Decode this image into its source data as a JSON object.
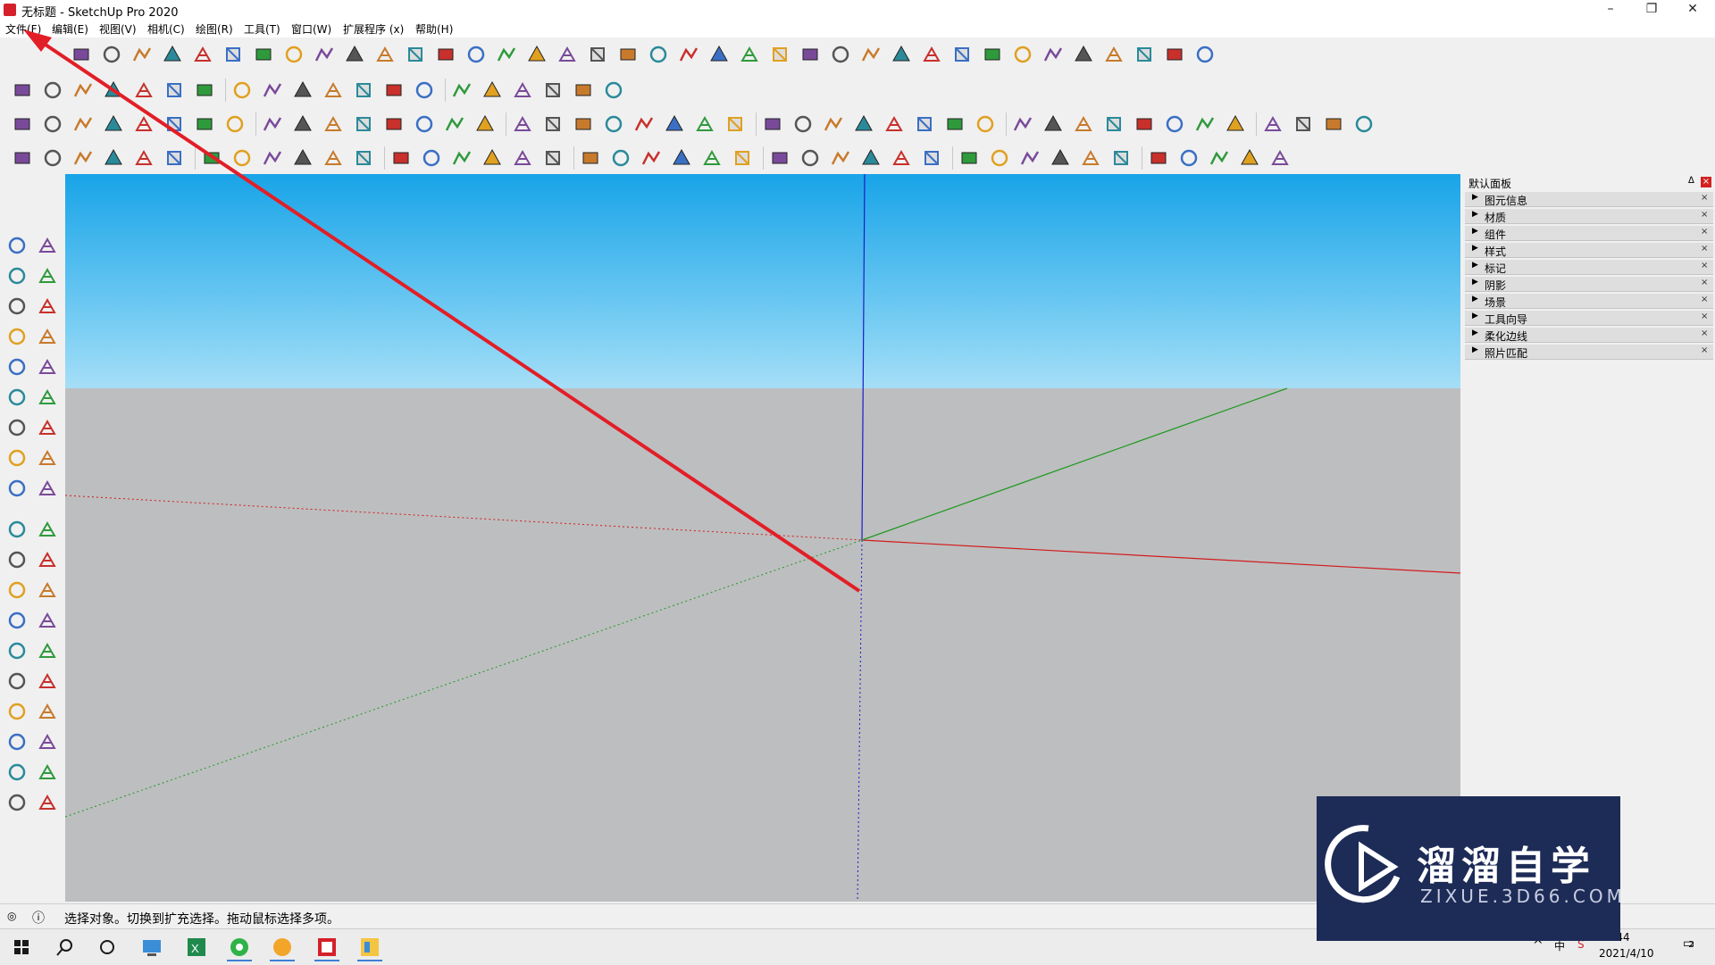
{
  "window": {
    "title": "无标题 - SketchUp Pro 2020",
    "minimize": "–",
    "maximize": "❐",
    "close": "✕"
  },
  "menu": [
    "文件(F)",
    "编辑(E)",
    "视图(V)",
    "相机(C)",
    "绘图(R)",
    "工具(T)",
    "窗口(W)",
    "扩展程序 (x)",
    "帮助(H)"
  ],
  "panel": {
    "title": "默认面板",
    "pin": "ᐃ",
    "close": "×",
    "items": [
      "图元信息",
      "材质",
      "组件",
      "样式",
      "标记",
      "阴影",
      "场景",
      "工具向导",
      "柔化边线",
      "照片匹配"
    ]
  },
  "status": {
    "text": "选择对象。切换到扩充选择。拖动鼠标选择多项。"
  },
  "clock": {
    "time": "16:44",
    "date": "2021/4/10",
    "notifications": "2"
  },
  "watermark": {
    "main": "溜溜自学",
    "sub": "ZIXUE.3D66.COM"
  },
  "icons": {
    "row1_count": 38,
    "row2_count": 20,
    "row3_count": 44,
    "row4_count": 41,
    "left_count": 38
  },
  "colors": {
    "sky_top": "#18a4e8",
    "ground": "#bdbec0",
    "axis_red": "#d21c1c",
    "axis_green": "#1f9a1f",
    "axis_blue": "#1c1cc8",
    "arrow": "#e21e26",
    "watermark_bg": "#1d2b57"
  }
}
